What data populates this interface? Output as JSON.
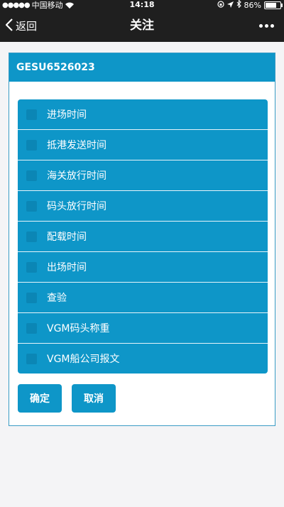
{
  "status_bar": {
    "signal_dots": "●●●●●",
    "carrier": "中国移动",
    "time": "14:18",
    "battery": "86%",
    "battery_level": 0.86
  },
  "nav": {
    "back_label": "返回",
    "title": "关注"
  },
  "card": {
    "header": "GESU6526023",
    "options": [
      "进场时间",
      "抵港发送时间",
      "海关放行时间",
      "码头放行时间",
      "配载时间",
      "出场时间",
      "查验",
      "VGM码头称重",
      "VGM船公司报文"
    ],
    "confirm_label": "确定",
    "cancel_label": "取消"
  },
  "colors": {
    "accent": "#0e96c8",
    "bar": "#1f1f1f"
  }
}
